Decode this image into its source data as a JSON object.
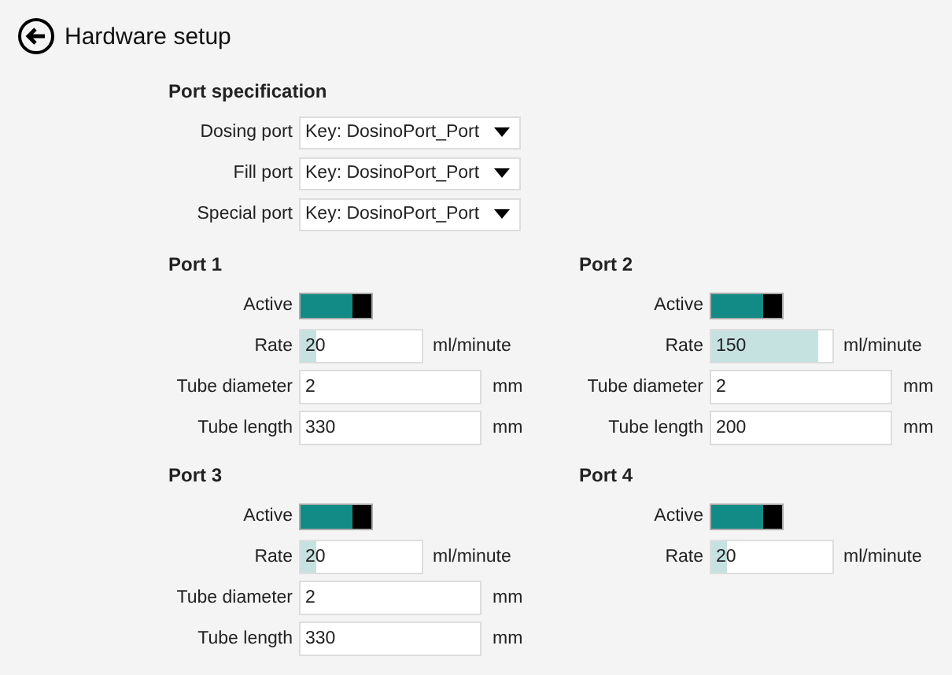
{
  "header": {
    "title": "Hardware setup"
  },
  "port_specification": {
    "heading": "Port specification",
    "rows": [
      {
        "label": "Dosing port",
        "value": "Key: DosinoPort_Port"
      },
      {
        "label": "Fill port",
        "value": "Key: DosinoPort_Port"
      },
      {
        "label": "Special port",
        "value": "Key: DosinoPort_Port"
      }
    ]
  },
  "ports": [
    {
      "heading": "Port 1",
      "fields": [
        {
          "kind": "toggle",
          "label": "Active",
          "on": true
        },
        {
          "kind": "rate",
          "label": "Rate",
          "value": "20",
          "level": 0.13,
          "unit": "ml/minute"
        },
        {
          "kind": "text",
          "label": "Tube diameter",
          "value": "2",
          "unit": "mm"
        },
        {
          "kind": "text",
          "label": "Tube length",
          "value": "330",
          "unit": "mm"
        }
      ]
    },
    {
      "heading": "Port 2",
      "fields": [
        {
          "kind": "toggle",
          "label": "Active",
          "on": true
        },
        {
          "kind": "rate",
          "label": "Rate",
          "value": "150",
          "level": 0.88,
          "unit": "ml/minute"
        },
        {
          "kind": "text",
          "label": "Tube diameter",
          "value": "2",
          "unit": "mm"
        },
        {
          "kind": "text",
          "label": "Tube length",
          "value": "200",
          "unit": "mm"
        }
      ]
    },
    {
      "heading": "Port 3",
      "fields": [
        {
          "kind": "toggle",
          "label": "Active",
          "on": true
        },
        {
          "kind": "rate",
          "label": "Rate",
          "value": "20",
          "level": 0.13,
          "unit": "ml/minute"
        },
        {
          "kind": "text",
          "label": "Tube diameter",
          "value": "2",
          "unit": "mm"
        },
        {
          "kind": "text",
          "label": "Tube length",
          "value": "330",
          "unit": "mm"
        }
      ]
    },
    {
      "heading": "Port 4",
      "fields": [
        {
          "kind": "toggle",
          "label": "Active",
          "on": true
        },
        {
          "kind": "rate",
          "label": "Rate",
          "value": "20",
          "level": 0.13,
          "unit": "ml/minute"
        }
      ]
    }
  ]
}
